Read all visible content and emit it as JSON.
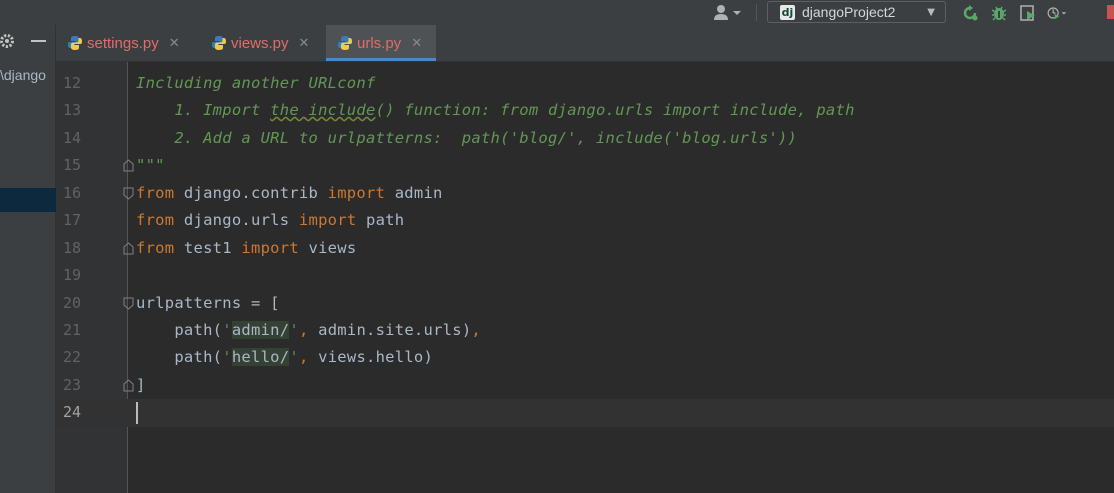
{
  "toolbar": {
    "run_config": "djangoProject2",
    "icons": [
      "user-icon",
      "django-icon",
      "rerun-icon",
      "debug-icon",
      "run-coverage-icon",
      "profile-icon"
    ]
  },
  "project_panel": {
    "path_fragment": "\\django"
  },
  "tabs": [
    {
      "label": "settings.py",
      "active": false
    },
    {
      "label": "views.py",
      "active": false
    },
    {
      "label": "urls.py",
      "active": true
    }
  ],
  "editor": {
    "lines": [
      {
        "num": "12",
        "text": "Including another URLconf"
      },
      {
        "num": "13",
        "text": "    1. Import the include() function: from django.urls import include, path"
      },
      {
        "num": "14",
        "text": "    2. Add a URL to urlpatterns:  path('blog/', include('blog.urls'))"
      },
      {
        "num": "15",
        "text": "\"\"\""
      },
      {
        "num": "16",
        "text": "from django.contrib import admin"
      },
      {
        "num": "17",
        "text": "from django.urls import path"
      },
      {
        "num": "18",
        "text": "from test1 import views"
      },
      {
        "num": "19",
        "text": ""
      },
      {
        "num": "20",
        "text": "urlpatterns = ["
      },
      {
        "num": "21",
        "text": "    path('admin/', admin.site.urls),"
      },
      {
        "num": "22",
        "text": "    path('hello/', views.hello)"
      },
      {
        "num": "23",
        "text": "]"
      },
      {
        "num": "24",
        "text": ""
      }
    ]
  },
  "colors": {
    "background": "#2b2b2b",
    "comment": "#629755",
    "keyword": "#cc7832",
    "string": "#6a8759",
    "text": "#a9b7c6",
    "tab_text": "#e06c6c",
    "active_tab_underline": "#4a88c7"
  }
}
